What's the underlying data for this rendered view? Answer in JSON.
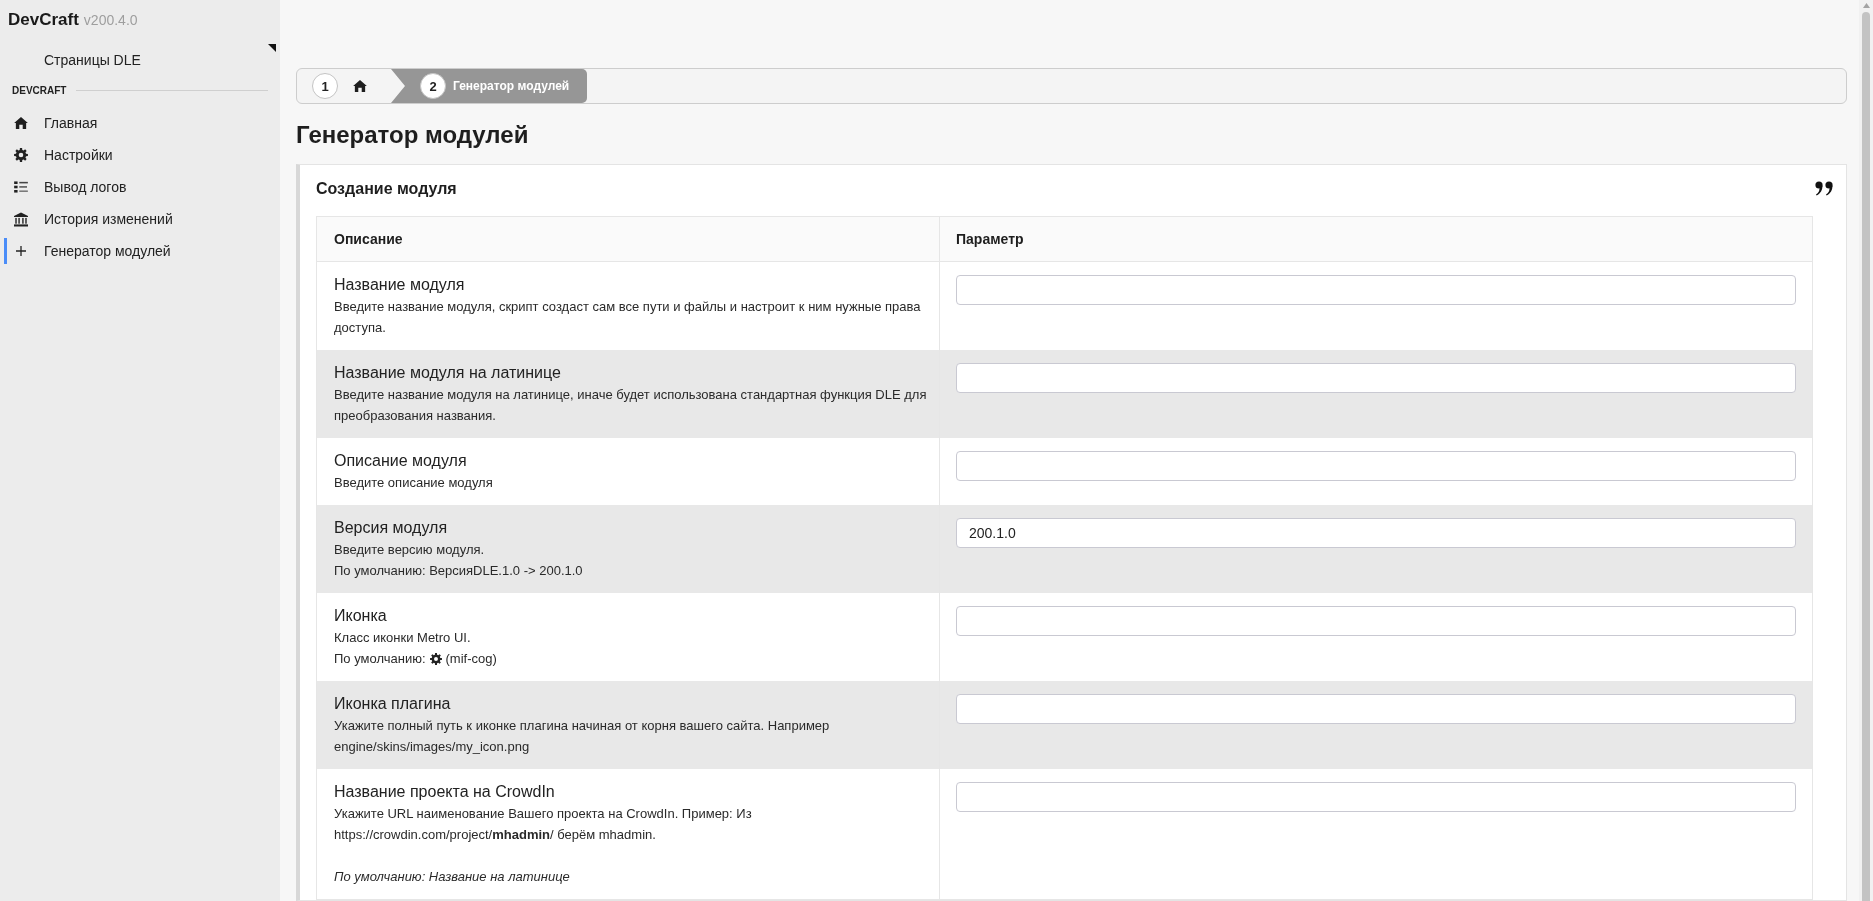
{
  "sidebar": {
    "brand": "DevCraft",
    "version": "v200.4.0",
    "pages_menu": {
      "label": "Страницы DLE"
    },
    "section": "DEVCRAFT",
    "items": [
      {
        "label": "Главная",
        "selected": false
      },
      {
        "label": "Настройки",
        "selected": false
      },
      {
        "label": "Вывод логов",
        "selected": false
      },
      {
        "label": "История изменений",
        "selected": false
      },
      {
        "label": "Генератор модулей",
        "selected": true
      }
    ]
  },
  "breadcrumbs": [
    {
      "kind": "home",
      "number": "1",
      "selected": false
    },
    {
      "kind": "page",
      "number": "2",
      "label": "Генератор модулей",
      "selected": true
    }
  ],
  "page_title": "Генератор модулей",
  "card": {
    "title": "Создание модуля",
    "table": {
      "columns": [
        "Описание",
        "Параметр"
      ],
      "rows": [
        {
          "title": "Название модуля",
          "lines": [
            {
              "kind": "text",
              "text": "Введите название модуля, скрипт создаст сам все пути и файлы и настроит к ним нужные права доступа."
            }
          ]
        },
        {
          "title": "Название модуля на латинице",
          "lines": [
            {
              "kind": "text",
              "text": "Введите название модуля на латинице, иначе будет использована стандартная функция DLE для преобразования названия."
            }
          ]
        },
        {
          "title": "Описание модуля",
          "lines": [
            {
              "kind": "text",
              "text": "Введите описание модуля"
            }
          ]
        },
        {
          "title": "Версия модуля",
          "lines": [
            {
              "kind": "text",
              "text": "Введите версию модуля."
            },
            {
              "kind": "text",
              "text": "По умолчанию: ВерсияDLE.1.0 -> 200.1.0"
            }
          ],
          "value": "200.1.0"
        },
        {
          "title": "Иконка",
          "lines": [
            {
              "kind": "text",
              "text": "Класс иконки Metro UI."
            },
            {
              "kind": "icon",
              "prefix": "По умолчанию:",
              "suffix": "(mif-cog)"
            }
          ]
        },
        {
          "title": "Иконка плагина",
          "lines": [
            {
              "kind": "text",
              "text": "Укажите полный путь к иконке плагина начиная от корня вашего сайта. Например engine/skins/images/my_icon.png"
            }
          ]
        },
        {
          "title": "Название проекта на CrowdIn",
          "lines": [
            {
              "kind": "text",
              "text": "Укажите URL наименование Вашего проекта на CrowdIn. Пример: Из https://crowdin.com/project/**mhadmin**/ берём mhadmin."
            },
            {
              "kind": "note",
              "text": "По умолчанию: Название на латинице"
            }
          ]
        }
      ]
    }
  }
}
